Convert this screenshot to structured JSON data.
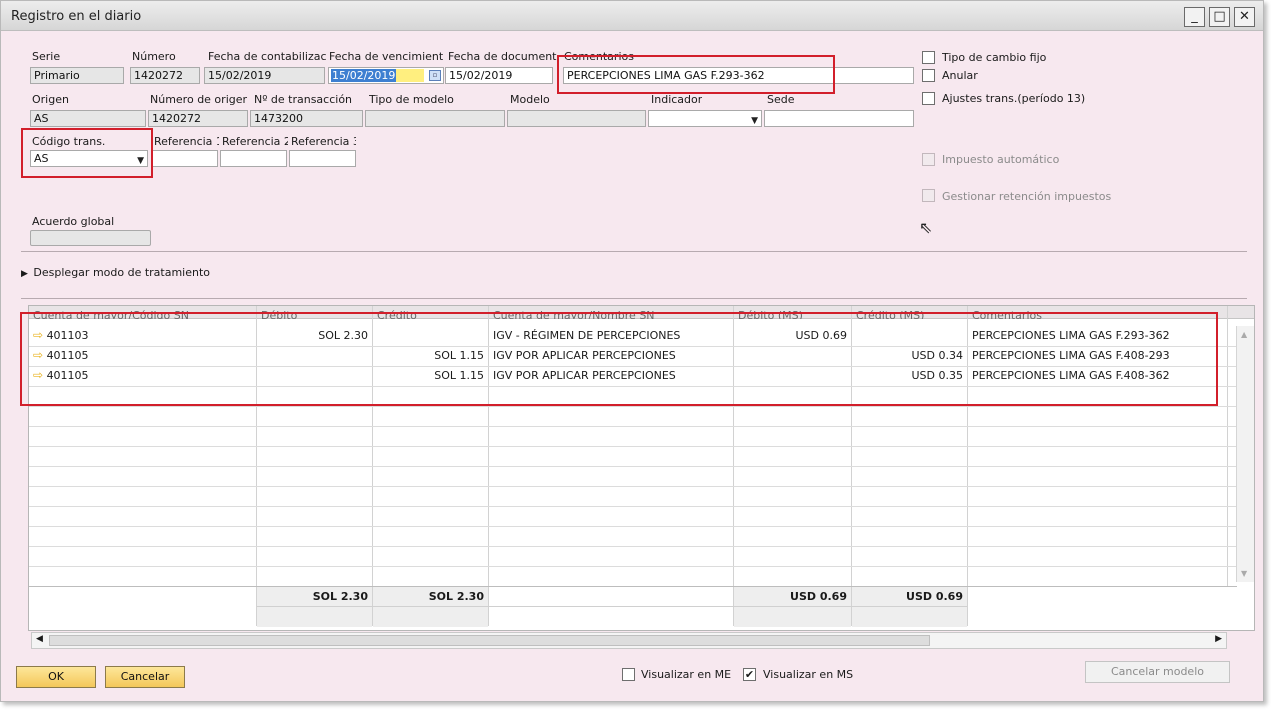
{
  "window": {
    "title": "Registro en el diario",
    "buttons": {
      "minimize": "_",
      "maximize": "□",
      "close": "✕"
    }
  },
  "header": {
    "labels": {
      "serie": "Serie",
      "numero": "Número",
      "fecha_contab": "Fecha de contabilizac",
      "fecha_venc": "Fecha de vencimient",
      "fecha_doc": "Fecha de document",
      "comentarios": "Comentarios",
      "origen": "Origen",
      "numero_origen": "Número de origer",
      "num_transaccion": "Nº de transacción",
      "tipo_modelo": "Tipo de modelo",
      "modelo": "Modelo",
      "indicador": "Indicador",
      "sede": "Sede",
      "codigo_trans": "Código trans.",
      "ref1": "Referencia 1",
      "ref2": "Referencia 2",
      "ref3": "Referencia 3",
      "acuerdo_global": "Acuerdo global"
    },
    "values": {
      "serie": "Primario",
      "numero": "1420272",
      "fecha_contab": "15/02/2019",
      "fecha_venc": "15/02/2019",
      "fecha_doc": "15/02/2019",
      "comentarios": "PERCEPCIONES LIMA GAS F.293-362",
      "origen": "AS",
      "numero_origen": "1420272",
      "num_transaccion": "1473200",
      "tipo_modelo": "",
      "modelo": "",
      "indicador": "",
      "sede": "",
      "codigo_trans": "AS",
      "ref1": "",
      "ref2": "",
      "ref3": "",
      "acuerdo_global": ""
    }
  },
  "options": {
    "tipo_cambio_fijo": {
      "label": "Tipo de cambio fijo",
      "checked": false
    },
    "anular": {
      "label": "Anular",
      "checked": false
    },
    "ajustes_trans": {
      "label": "Ajustes trans.(período 13)",
      "checked": false
    },
    "impuesto_automatico": {
      "label": "Impuesto automático",
      "checked": false,
      "disabled": true
    },
    "gestionar_retencion": {
      "label": "Gestionar retención impuestos",
      "checked": false,
      "disabled": true
    }
  },
  "expander": {
    "label": "Desplegar modo de tratamiento"
  },
  "table": {
    "columns": [
      "Cuenta de mayor/Código SN",
      "Débito",
      "Crédito",
      "Cuenta de mayor/Nombre SN",
      "Débito (MS)",
      "Crédito (MS)",
      "Comentarios"
    ],
    "rows": [
      {
        "cuenta": "401103",
        "debito": "SOL 2.30",
        "credito": "",
        "nombre": "IGV - RÉGIMEN DE PERCEPCIONES",
        "debito_ms": "USD 0.69",
        "credito_ms": "",
        "comentarios": "PERCEPCIONES LIMA GAS F.293-362"
      },
      {
        "cuenta": "401105",
        "debito": "",
        "credito": "SOL 1.15",
        "nombre": "IGV POR APLICAR PERCEPCIONES",
        "debito_ms": "",
        "credito_ms": "USD 0.34",
        "comentarios": "PERCEPCIONES LIMA GAS F.408-293"
      },
      {
        "cuenta": "401105",
        "debito": "",
        "credito": "SOL 1.15",
        "nombre": "IGV POR APLICAR PERCEPCIONES",
        "debito_ms": "",
        "credito_ms": "USD 0.35",
        "comentarios": "PERCEPCIONES LIMA GAS F.408-362"
      }
    ],
    "totals": {
      "debito": "SOL 2.30",
      "credito": "SOL 2.30",
      "debito_ms": "USD 0.69",
      "credito_ms": "USD 0.69"
    },
    "row_icon": "arrow-right-icon"
  },
  "footer": {
    "ok": "OK",
    "cancelar": "Cancelar",
    "visualizar_me": {
      "label": "Visualizar en ME",
      "checked": false
    },
    "visualizar_ms": {
      "label": "Visualizar en MS",
      "checked": true
    },
    "cancelar_modelo": "Cancelar modelo",
    "checkmark": "✔"
  },
  "colors": {
    "window_bg": "#f7e8ef",
    "highlight": "#d21f2b",
    "button": "#f4c75a",
    "selection": "#3d7fd1"
  }
}
